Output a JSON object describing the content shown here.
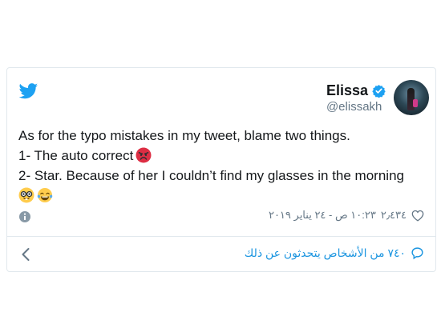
{
  "tweet": {
    "author": {
      "display_name": "Elissa",
      "handle": "@elissakh",
      "verified_icon": "verified-badge-icon"
    },
    "text_lines": [
      "As for the typo mistakes in my tweet, blame two things.",
      "1- The auto correct",
      "2- Star. Because of her I couldn’t find my glasses in the morning"
    ],
    "emojis": {
      "line2": "angry-face-emoji",
      "line4": [
        "nerd-face-emoji",
        "tears-of-joy-emoji"
      ]
    },
    "likes": "٢٫٤٣٤",
    "timestamp": "١٠:٢٣ ص - ٢٤ يناير ٢٠١٩",
    "conversation_text": "٧٤٠ من الأشخاص يتحدثون عن ذلك"
  },
  "icons": {
    "logo": "twitter-bird-icon",
    "info": "info-icon",
    "like": "heart-icon",
    "reply": "speech-bubble-icon",
    "back": "chevron-left-icon"
  },
  "colors": {
    "twitter_blue": "#1da1f2",
    "link_blue": "#1b95e0",
    "text": "#14171a",
    "muted": "#657786",
    "border": "#e1e8ed"
  }
}
